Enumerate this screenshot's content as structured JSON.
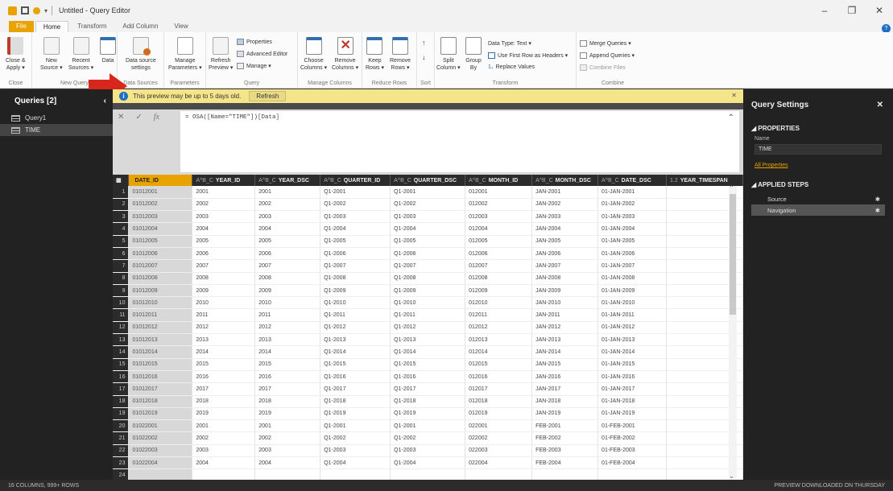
{
  "window": {
    "title": "Untitled - Query Editor",
    "controls": [
      "‒",
      "❐",
      "✕"
    ]
  },
  "tabs": [
    "File",
    "Home",
    "Transform",
    "Add Column",
    "View"
  ],
  "ribbon": {
    "close_group": {
      "label": "Close",
      "close_apply": "Close &",
      "close_apply2": "Apply ▾"
    },
    "new_query_group": {
      "label": "New Query",
      "new_source": "New",
      "new_source2": "Source ▾",
      "recent_sources": "Recent",
      "recent_sources2": "Sources ▾",
      "enter_data": "Data"
    },
    "data_sources_group": {
      "label": "Data Sources",
      "data_source_settings": "Data source",
      "data_source_settings2": "settings"
    },
    "parameters_group": {
      "label": "Parameters",
      "manage_parameters": "Manage",
      "manage_parameters2": "Parameters ▾"
    },
    "query_group": {
      "label": "Query",
      "refresh_preview": "Refresh",
      "refresh_preview2": "Preview ▾",
      "properties": "Properties",
      "advanced_editor": "Advanced Editor",
      "manage": "Manage ▾"
    },
    "manage_columns_group": {
      "label": "Manage Columns",
      "choose_columns": "Choose",
      "choose_columns2": "Columns ▾",
      "remove_columns": "Remove",
      "remove_columns2": "Columns ▾"
    },
    "reduce_rows_group": {
      "label": "Reduce Rows",
      "keep_rows": "Keep",
      "keep_rows2": "Rows ▾",
      "remove_rows": "Remove",
      "remove_rows2": "Rows ▾"
    },
    "sort_group": {
      "label": "Sort"
    },
    "transform_group": {
      "label": "Transform",
      "split_column": "Split",
      "split_column2": "Column ▾",
      "group_by": "Group",
      "group_by2": "By",
      "data_type": "Data Type: Text ▾",
      "use_first_row": "Use First Row as Headers ▾",
      "replace_values": "Replace Values"
    },
    "combine_group": {
      "label": "Combine",
      "merge_queries": "Merge Queries ▾",
      "append_queries": "Append Queries ▾",
      "combine_files": "Combine Files"
    }
  },
  "queries": {
    "header": "Queries [2]",
    "items": [
      "Query1",
      "TIME"
    ]
  },
  "warning": {
    "text": "This preview may be up to 5 days old.",
    "refresh": "Refresh"
  },
  "formula": "= OSA([Name=\"TIME\"])[Data]",
  "grid": {
    "columns": [
      {
        "type": "",
        "name": "DATE_ID"
      },
      {
        "type": "A^B_C",
        "name": "YEAR_ID"
      },
      {
        "type": "A^B_C",
        "name": "YEAR_DSC"
      },
      {
        "type": "A^B_C",
        "name": "QUARTER_ID"
      },
      {
        "type": "A^B_C",
        "name": "QUARTER_DSC"
      },
      {
        "type": "A^B_C",
        "name": "MONTH_ID"
      },
      {
        "type": "A^B_C",
        "name": "MONTH_DSC"
      },
      {
        "type": "A^B_C",
        "name": "DATE_DSC"
      },
      {
        "type": "1.2",
        "name": "YEAR_TIMESPAN"
      }
    ],
    "rows": [
      [
        "01012001",
        "2001",
        "2001",
        "Q1-2001",
        "Q1-2001",
        "012001",
        "JAN-2001",
        "01-JAN-2001",
        ""
      ],
      [
        "01012002",
        "2002",
        "2002",
        "Q1-2002",
        "Q1-2002",
        "012002",
        "JAN-2002",
        "01-JAN-2002",
        ""
      ],
      [
        "01012003",
        "2003",
        "2003",
        "Q1-2003",
        "Q1-2003",
        "012003",
        "JAN-2003",
        "01-JAN-2003",
        ""
      ],
      [
        "01012004",
        "2004",
        "2004",
        "Q1-2004",
        "Q1-2004",
        "012004",
        "JAN-2004",
        "01-JAN-2004",
        ""
      ],
      [
        "01012005",
        "2005",
        "2005",
        "Q1-2005",
        "Q1-2005",
        "012005",
        "JAN-2005",
        "01-JAN-2005",
        ""
      ],
      [
        "01012006",
        "2006",
        "2006",
        "Q1-2006",
        "Q1-2006",
        "012006",
        "JAN-2006",
        "01-JAN-2006",
        ""
      ],
      [
        "01012007",
        "2007",
        "2007",
        "Q1-2007",
        "Q1-2007",
        "012007",
        "JAN-2007",
        "01-JAN-2007",
        ""
      ],
      [
        "01012008",
        "2008",
        "2008",
        "Q1-2008",
        "Q1-2008",
        "012008",
        "JAN-2008",
        "01-JAN-2008",
        ""
      ],
      [
        "01012009",
        "2009",
        "2009",
        "Q1-2009",
        "Q1-2009",
        "012009",
        "JAN-2009",
        "01-JAN-2009",
        ""
      ],
      [
        "01012010",
        "2010",
        "2010",
        "Q1-2010",
        "Q1-2010",
        "012010",
        "JAN-2010",
        "01-JAN-2010",
        ""
      ],
      [
        "01012011",
        "2011",
        "2011",
        "Q1-2011",
        "Q1-2011",
        "012011",
        "JAN-2011",
        "01-JAN-2011",
        ""
      ],
      [
        "01012012",
        "2012",
        "2012",
        "Q1-2012",
        "Q1-2012",
        "012012",
        "JAN-2012",
        "01-JAN-2012",
        ""
      ],
      [
        "01012013",
        "2013",
        "2013",
        "Q1-2013",
        "Q1-2013",
        "012013",
        "JAN-2013",
        "01-JAN-2013",
        ""
      ],
      [
        "01012014",
        "2014",
        "2014",
        "Q1-2014",
        "Q1-2014",
        "012014",
        "JAN-2014",
        "01-JAN-2014",
        ""
      ],
      [
        "01012015",
        "2015",
        "2015",
        "Q1-2015",
        "Q1-2015",
        "012015",
        "JAN-2015",
        "01-JAN-2015",
        ""
      ],
      [
        "01012016",
        "2016",
        "2016",
        "Q1-2016",
        "Q1-2016",
        "012016",
        "JAN-2016",
        "01-JAN-2016",
        ""
      ],
      [
        "01012017",
        "2017",
        "2017",
        "Q1-2017",
        "Q1-2017",
        "012017",
        "JAN-2017",
        "01-JAN-2017",
        ""
      ],
      [
        "01012018",
        "2018",
        "2018",
        "Q1-2018",
        "Q1-2018",
        "012018",
        "JAN-2018",
        "01-JAN-2018",
        ""
      ],
      [
        "01012019",
        "2019",
        "2019",
        "Q1-2019",
        "Q1-2019",
        "012019",
        "JAN-2019",
        "01-JAN-2019",
        ""
      ],
      [
        "01022001",
        "2001",
        "2001",
        "Q1-2001",
        "Q1-2001",
        "022001",
        "FEB-2001",
        "01-FEB-2001",
        ""
      ],
      [
        "01022002",
        "2002",
        "2002",
        "Q1-2002",
        "Q1-2002",
        "022002",
        "FEB-2002",
        "01-FEB-2002",
        ""
      ],
      [
        "01022003",
        "2003",
        "2003",
        "Q1-2003",
        "Q1-2003",
        "022003",
        "FEB-2003",
        "01-FEB-2003",
        ""
      ],
      [
        "01022004",
        "2004",
        "2004",
        "Q1-2004",
        "Q1-2004",
        "022004",
        "FEB-2004",
        "01-FEB-2004",
        ""
      ],
      [
        "",
        "",
        "",
        "",
        "",
        "",
        "",
        "",
        ""
      ]
    ]
  },
  "settings": {
    "header": "Query Settings",
    "properties": "PROPERTIES",
    "name_label": "Name",
    "name_value": "TIME",
    "all_properties": "All Properties",
    "applied_steps": "APPLIED STEPS",
    "steps": [
      "Source",
      "Navigation"
    ]
  },
  "status": {
    "left": "16 COLUMNS, 999+ ROWS",
    "right": "PREVIEW DOWNLOADED ON THURSDAY"
  },
  "colors": {
    "accent": "#e8a300",
    "arrow": "#d9261c",
    "info": "#1f6fc5"
  }
}
